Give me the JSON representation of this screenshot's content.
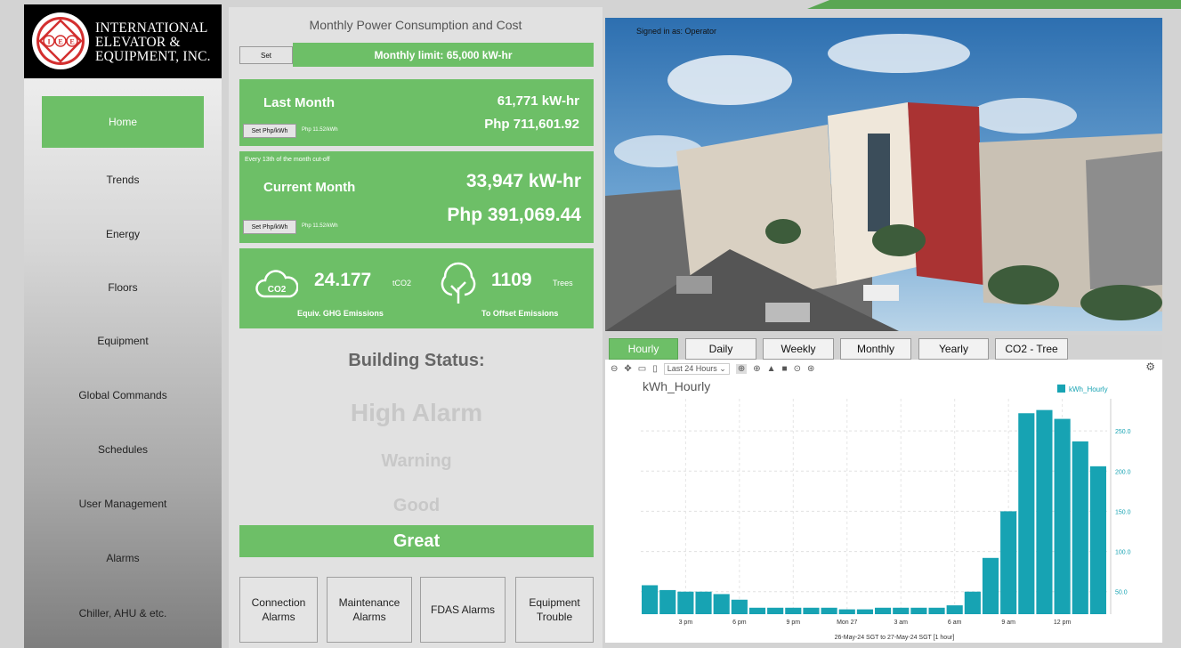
{
  "logo": {
    "line1": "INTERNATIONAL",
    "line2": "ELEVATOR &",
    "line3": "EQUIPMENT, INC.",
    "mark": "IEE"
  },
  "nav": [
    {
      "label": "Home"
    },
    {
      "label": "Trends"
    },
    {
      "label": "Energy"
    },
    {
      "label": "Floors"
    },
    {
      "label": "Equipment"
    },
    {
      "label": "Global Commands"
    },
    {
      "label": "Schedules"
    },
    {
      "label": "User Management"
    },
    {
      "label": "Alarms"
    },
    {
      "label": "Chiller, AHU & etc."
    }
  ],
  "consumption": {
    "title": "Monthly Power Consumption and Cost",
    "set_label": "Set",
    "limit_text": "Monthly limit: 65,000 kW-hr",
    "last_month": {
      "label": "Last Month",
      "kwh": "61,771 kW-hr",
      "cost": "Php 711,601.92",
      "set_rate_label": "Set Php/kWh",
      "rate": "Php 11.52/kWh"
    },
    "current_month": {
      "cutoff": "Every 13th of the month cut-off",
      "label": "Current Month",
      "kwh": "33,947 kW-hr",
      "cost": "Php 391,069.44",
      "set_rate_label": "Set Php/kWh",
      "rate": "Php 11.52/kWh"
    },
    "emissions": {
      "value": "24.177",
      "unit": "tCO2",
      "caption": "Equiv. GHG Emissions",
      "co2_icon": "CO2"
    },
    "trees": {
      "value": "1109",
      "unit": "Trees",
      "caption": "To Offset Emissions"
    }
  },
  "status": {
    "title": "Building Status:",
    "levels": [
      "High Alarm",
      "Warning",
      "Good",
      "Great"
    ]
  },
  "alarm_buttons": [
    {
      "line1": "Connection",
      "line2": "Alarms"
    },
    {
      "line1": "Maintenance",
      "line2": "Alarms"
    },
    {
      "line1": "FDAS Alarms",
      "line2": ""
    },
    {
      "line1": "Equipment",
      "line2": "Trouble"
    }
  ],
  "signed_in": "Signed in as: Operator",
  "tabs": [
    "Hourly",
    "Daily",
    "Weekly",
    "Monthly",
    "Yearly",
    "CO2 - Tree"
  ],
  "chart_toolbar": {
    "range_select": "Last 24 Hours"
  },
  "colors": {
    "green": "#6dbf67",
    "bar": "#17a3b3"
  },
  "chart_data": {
    "type": "bar",
    "title": "kWh_Hourly",
    "series": [
      {
        "name": "kWh_Hourly",
        "values": [
          58,
          52,
          50,
          50,
          47,
          40,
          30,
          30,
          30,
          30,
          30,
          28,
          28,
          30,
          30,
          30,
          30,
          33,
          50,
          92,
          150,
          272,
          276,
          265,
          237,
          206
        ]
      }
    ],
    "x_tick_labels": [
      "3 pm",
      "6 pm",
      "9 pm",
      "Mon 27",
      "3 am",
      "6 am",
      "9 am",
      "12 pm"
    ],
    "x_subtitle": "26-May-24 SGT to 27-May-24 SGT   [1 hour]",
    "y_tick_labels": [
      "50.0",
      "100.0",
      "150.0",
      "200.0",
      "250.0"
    ],
    "ylim": [
      22,
      290
    ],
    "legend": "top-right"
  }
}
